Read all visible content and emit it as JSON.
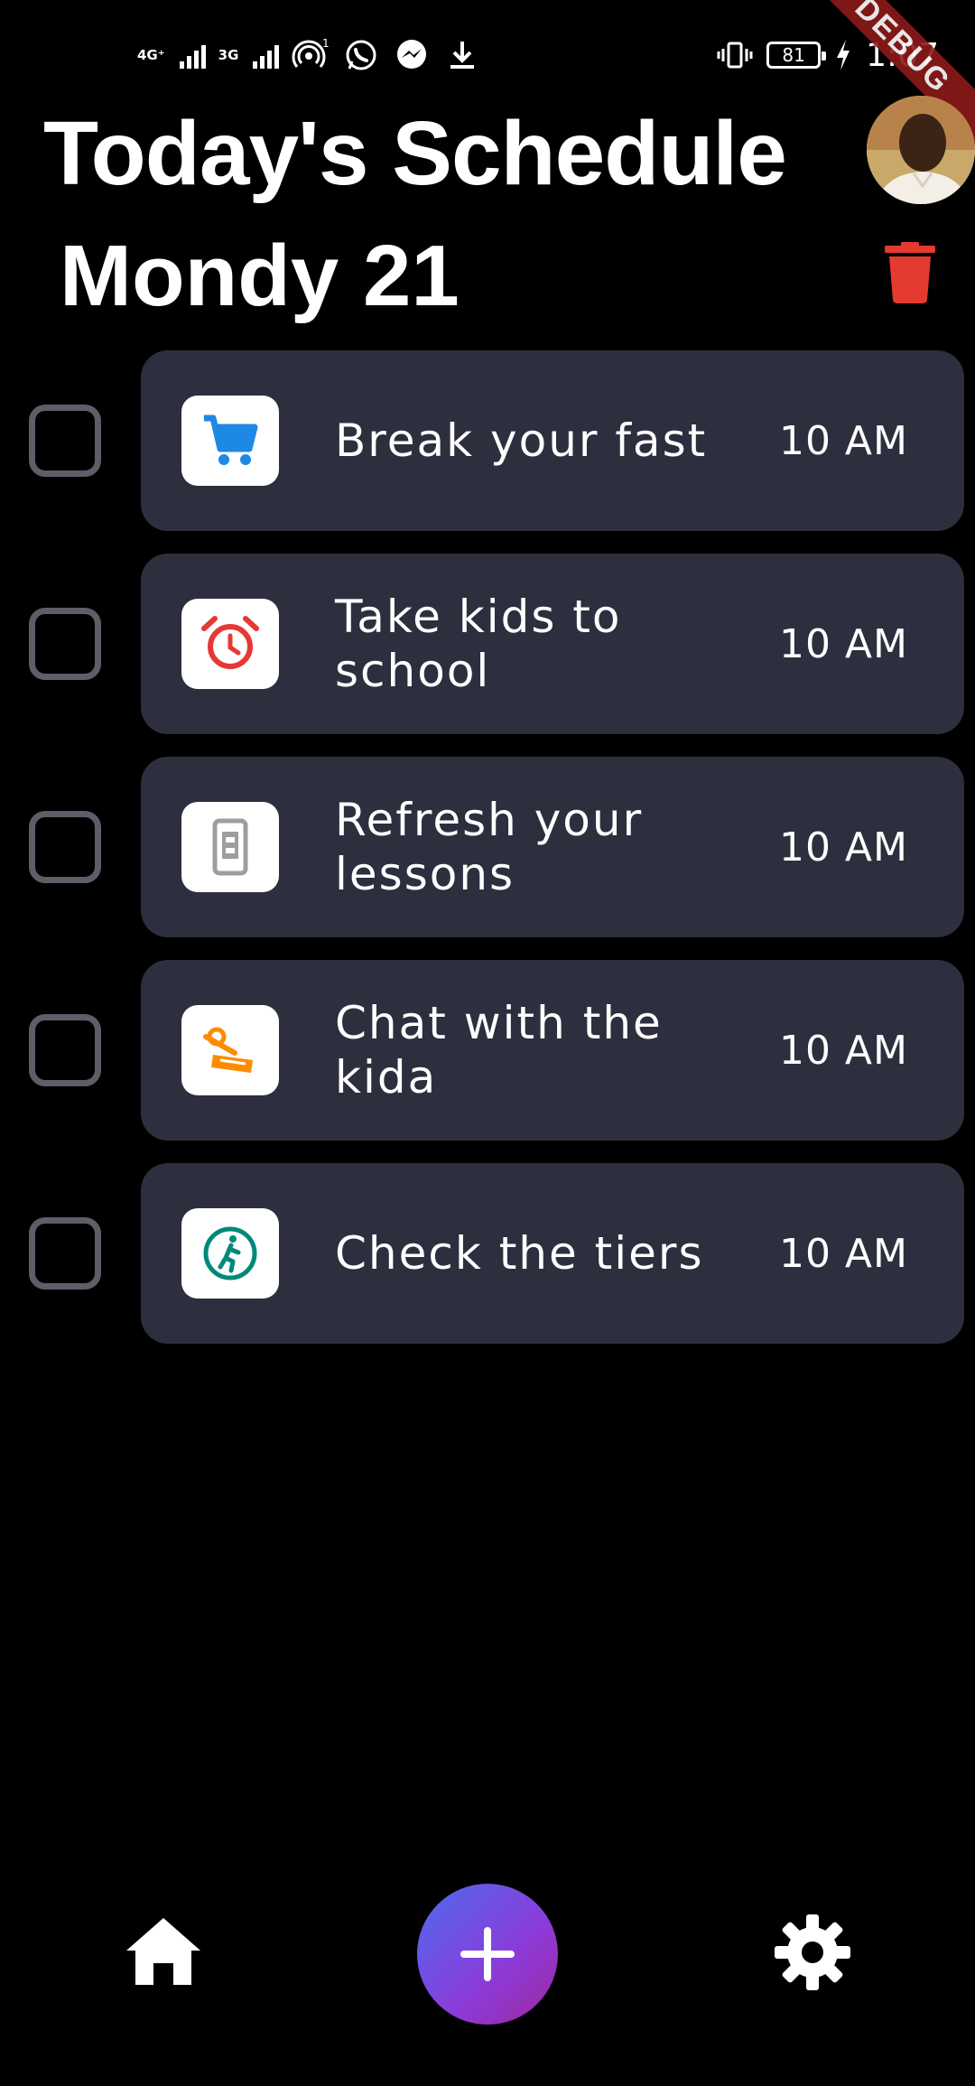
{
  "status_bar": {
    "network_1": "4G⁺",
    "network_2": "3G",
    "hotspot_count": "1",
    "battery_level": "81",
    "time": "1:07",
    "icons": [
      "signal-icon",
      "hotspot-icon",
      "whatsapp-icon",
      "messenger-icon",
      "download-icon",
      "vibrate-icon",
      "battery-icon",
      "charging-icon"
    ]
  },
  "debug_banner": "DEBUG",
  "header": {
    "title": "Today's Schedule",
    "subtitle": "Mondy 21",
    "delete_icon": "trash-icon",
    "delete_color": "#e53a2f",
    "avatar_icon": "profile-avatar"
  },
  "tasks": [
    {
      "label": "Break your fast",
      "time": "10 AM",
      "icon": "shopping-cart-icon",
      "icon_color": "#1e88e5",
      "checked": false
    },
    {
      "label": "Take kids to school",
      "time": "10 AM",
      "icon": "alarm-clock-icon",
      "icon_color": "#e53935",
      "checked": false
    },
    {
      "label": "Refresh your lessons",
      "time": "10 AM",
      "icon": "phone-icon",
      "icon_color": "#9e9e9e",
      "checked": false
    },
    {
      "label": "Chat with the kida",
      "time": "10 AM",
      "icon": "ticket-icon",
      "icon_color": "#fb8c00",
      "checked": false
    },
    {
      "label": "Check the tiers",
      "time": "10 AM",
      "icon": "run-icon",
      "icon_color": "#00897b",
      "checked": false
    }
  ],
  "bottom_nav": {
    "home_icon": "home-icon",
    "add_icon": "plus-icon",
    "settings_icon": "settings-icon",
    "fab_colors": [
      "#4d6bf0",
      "#a0279c"
    ]
  }
}
